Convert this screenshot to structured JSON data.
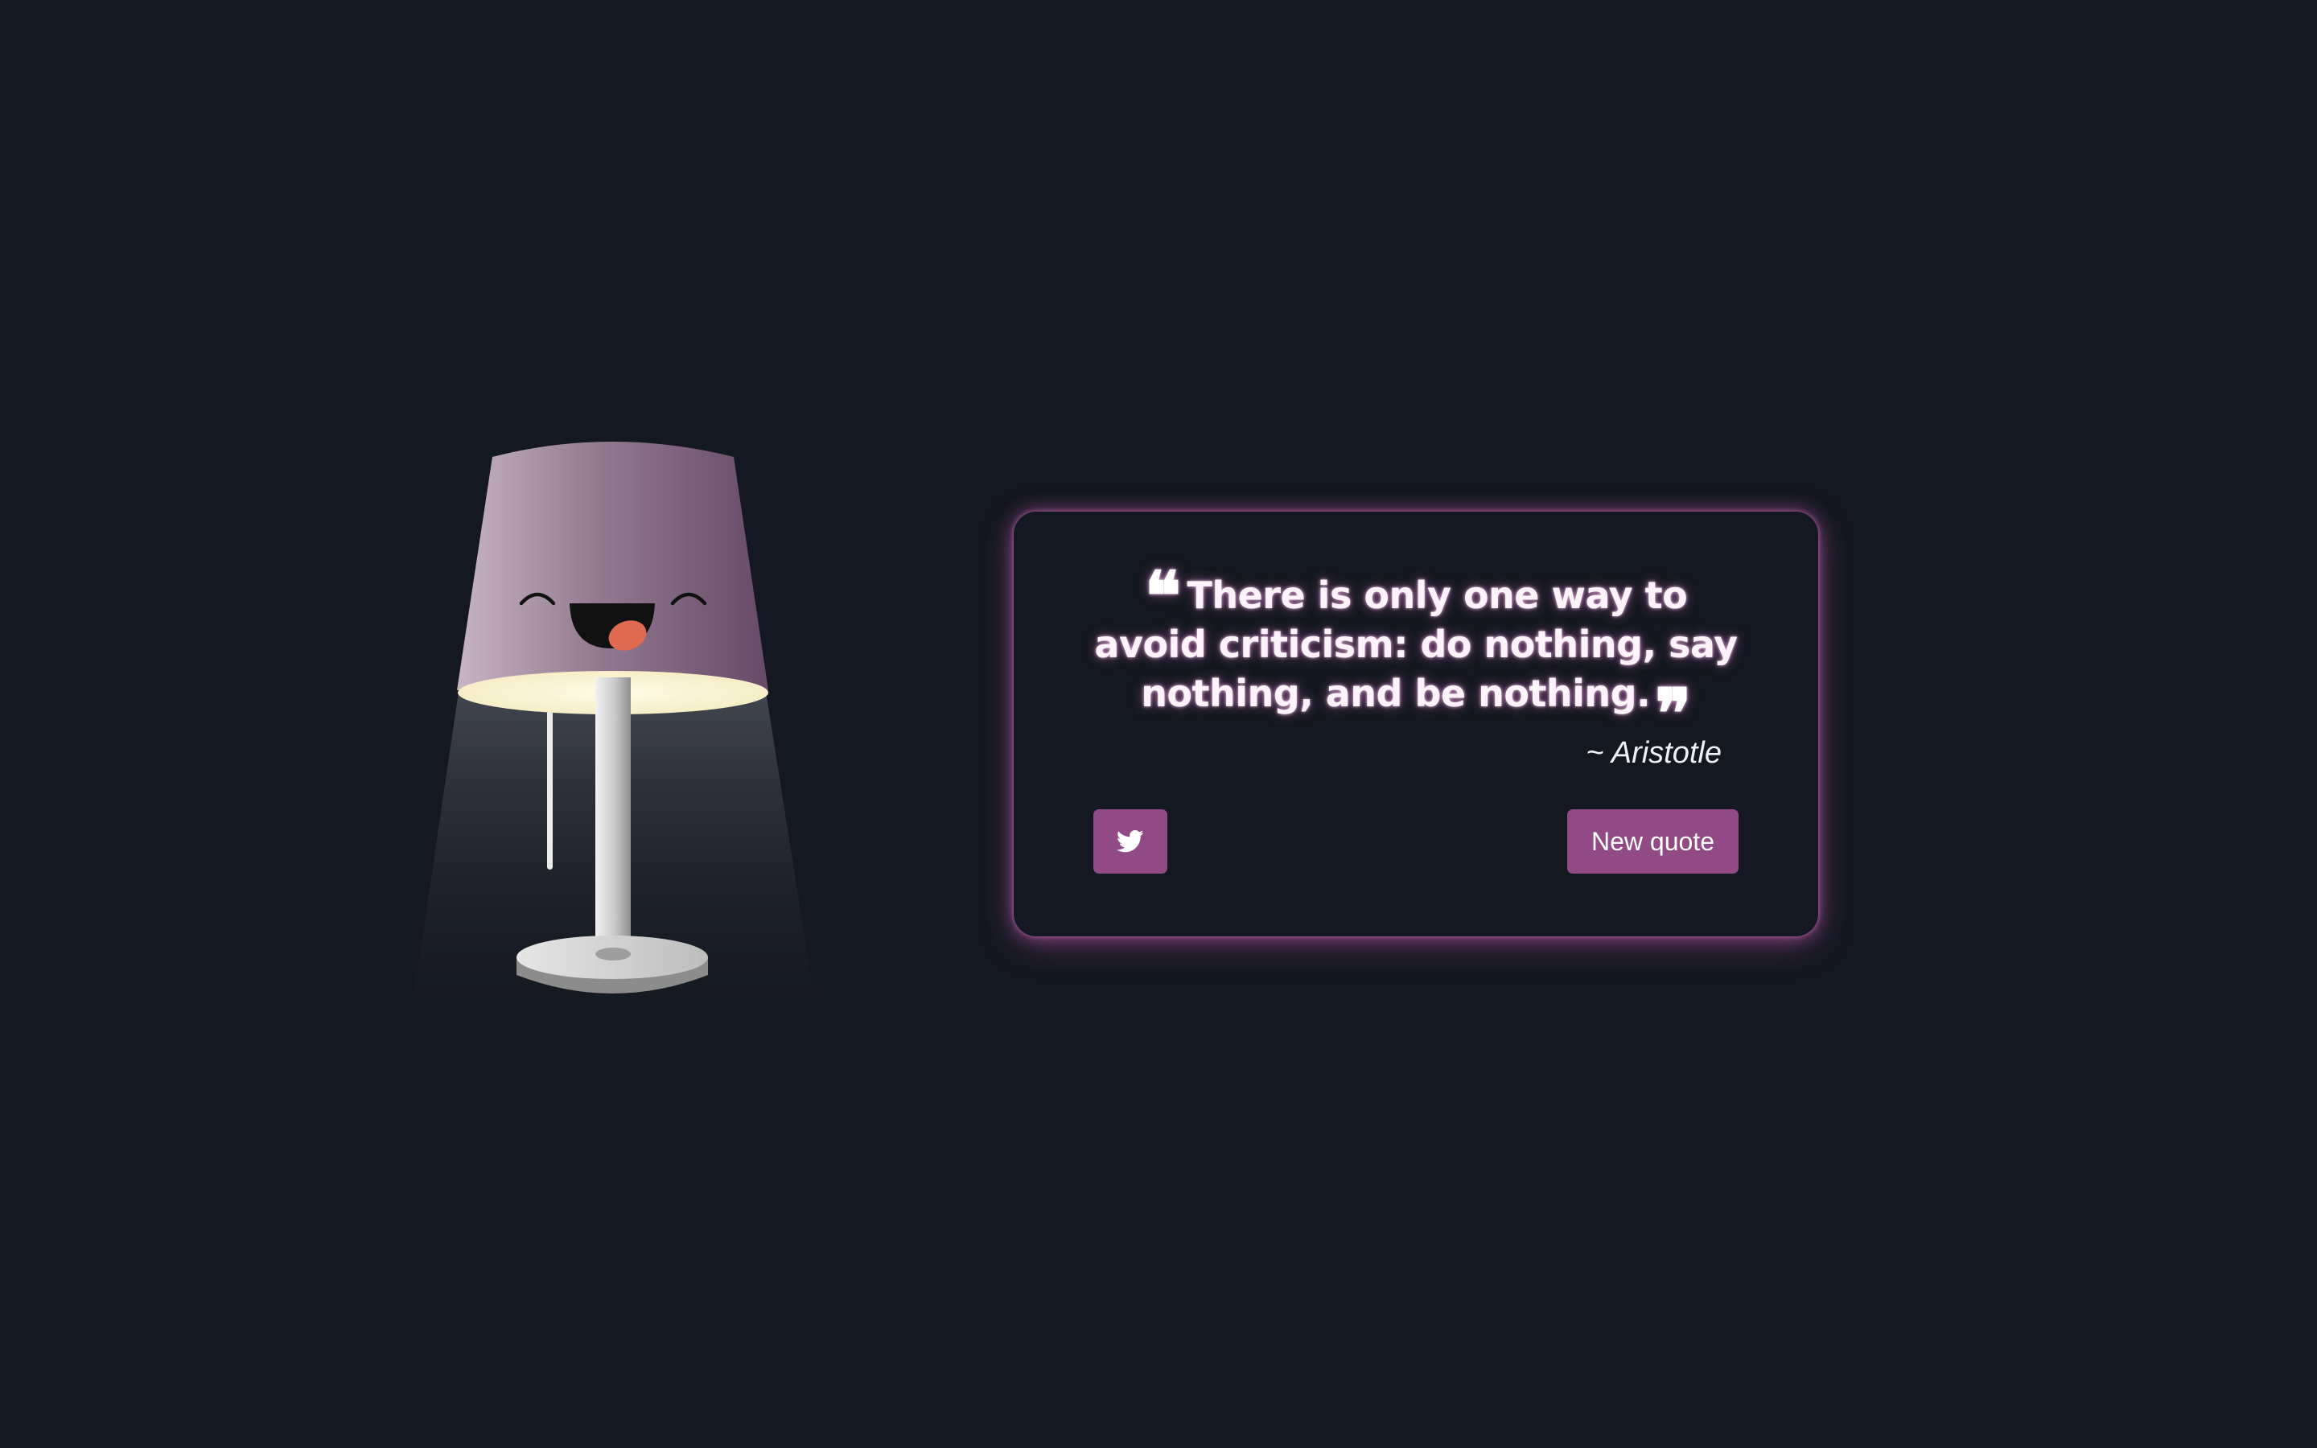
{
  "colors": {
    "background": "#141820",
    "accent": "#924a86",
    "glow": "#d064be",
    "lamp_shade": "#9a7a95",
    "lamp_light": "#fdf6d6"
  },
  "lamp": {
    "face": "smiling-tongue-out"
  },
  "quote": {
    "open_mark": "❝",
    "text": "There is only one way to avoid criticism: do nothing, say nothing, and be nothing.",
    "close_mark": "❞",
    "author": "~ Aristotle"
  },
  "actions": {
    "tweet_icon": "twitter-bird-icon",
    "new_quote_label": "New quote"
  }
}
